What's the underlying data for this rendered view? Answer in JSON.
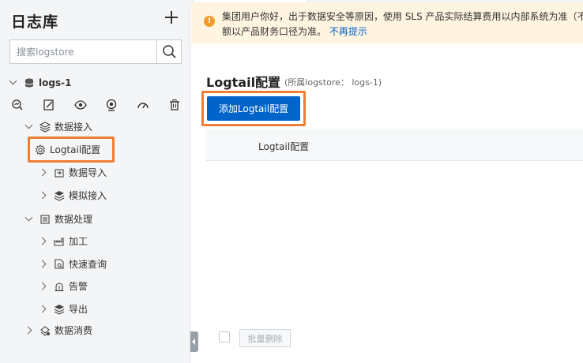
{
  "sidebar": {
    "title": "日志库",
    "search": {
      "placeholder": "搜索logstore",
      "value": ""
    },
    "project": {
      "name": "logs-1"
    },
    "toolbar_icons": [
      "query-icon",
      "edit-icon",
      "eye-icon",
      "alert-icon",
      "dashboard-icon",
      "delete-icon"
    ],
    "tree": [
      {
        "label": "数据接入",
        "expanded": true
      },
      {
        "label": "Logtail配置",
        "selected": true
      },
      {
        "label": "数据导入"
      },
      {
        "label": "模拟接入"
      },
      {
        "label": "数据处理",
        "expanded": true
      },
      {
        "label": "加工"
      },
      {
        "label": "快速查询"
      },
      {
        "label": "告警"
      },
      {
        "label": "导出"
      },
      {
        "label": "数据消费"
      }
    ]
  },
  "notice": {
    "line1": "集团用户你好，出于数据安全等原因，使用 SLS 产品实际结算费用以内部系统为准（不",
    "line2": "额以产品财务口径为准。",
    "link": "不再提示"
  },
  "main": {
    "title": "Logtail配置",
    "subtitle": "(所属logstore： logs-1)",
    "add_button": "添加Logtail配置",
    "table": {
      "columns": [
        "Logtail配置"
      ]
    },
    "batch_delete": "批量删除"
  },
  "colors": {
    "accent": "#0064c8",
    "highlight": "#ef7d34",
    "notice_bg": "#fff4e0",
    "warning": "#f19b2c"
  }
}
